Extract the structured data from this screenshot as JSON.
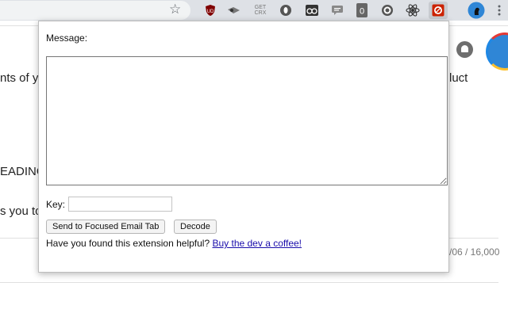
{
  "browser": {
    "bookmark_icon": "star-outline-icon",
    "extensions": [
      {
        "name": "ublock-origin-icon",
        "label": "UD",
        "color": "#800000"
      },
      {
        "name": "spy-glasses-icon",
        "label": "",
        "color": "#555555"
      },
      {
        "name": "get-crx-icon",
        "label": "GET CRX",
        "color": "#888888"
      },
      {
        "name": "circle-o-icon",
        "label": "",
        "color": "#555555"
      },
      {
        "name": "glasses-icon",
        "label": "",
        "color": "#333333"
      },
      {
        "name": "chat-bubble-icon",
        "label": "",
        "color": "#777777"
      },
      {
        "name": "zero-icon",
        "label": "0",
        "color": "#666666"
      },
      {
        "name": "target-icon",
        "label": "",
        "color": "#555555"
      },
      {
        "name": "react-atom-icon",
        "label": "",
        "color": "#333333"
      },
      {
        "name": "email-encrypt-extension-icon",
        "label": "",
        "color": "#cc2200",
        "active": true
      },
      {
        "name": "profile-avatar-icon",
        "label": "",
        "color": "#2f86d6"
      }
    ],
    "menu_icon": "more-vertical-icon"
  },
  "background_page": {
    "line1_left": "nts of y",
    "line1_right": "luct",
    "line2": "EADING",
    "line3": "s you to",
    "counter": "/06 / 16,000",
    "bell_icon": "notification-bell-icon",
    "avatar": "profile-avatar-icon"
  },
  "popup": {
    "message_label": "Message:",
    "message_value": "",
    "key_label": "Key:",
    "key_value": "",
    "send_button": "Send to Focused Email Tab",
    "decode_button": "Decode",
    "helpful_text": "Have you found this extension helpful?",
    "coffee_link": "Buy the dev a coffee!"
  }
}
